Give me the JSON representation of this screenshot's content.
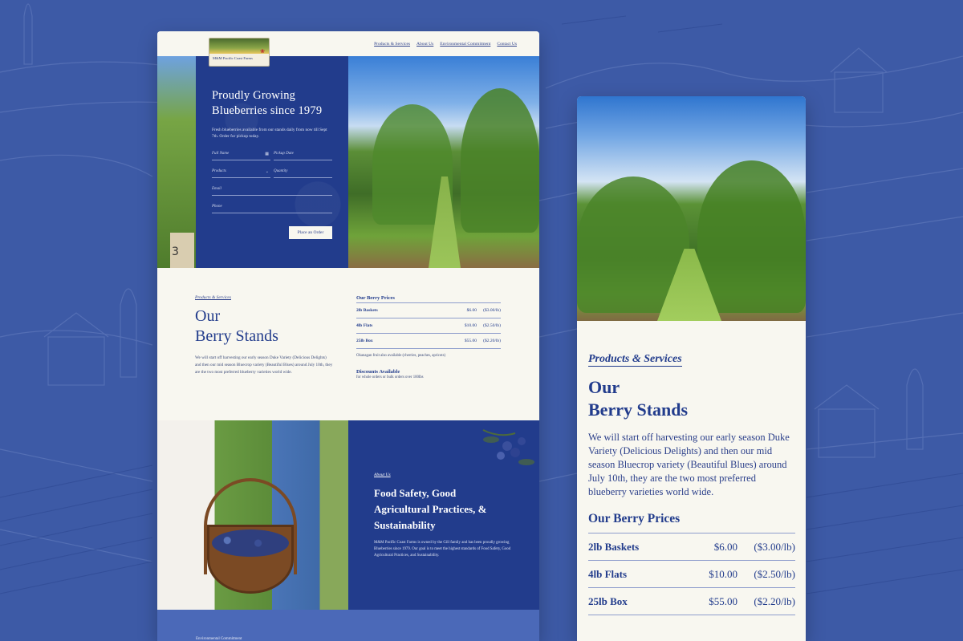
{
  "colors": {
    "background": "#3d5aa6",
    "navy": "#223c8c",
    "cream": "#f8f7f0",
    "accent_blue": "#4b69b8"
  },
  "desktop": {
    "logo_text": "M&M Pacific Coast Farms",
    "nav": [
      "Products & Services",
      "About Us",
      "Environmental Commitment",
      "Contact Us"
    ],
    "hero": {
      "title": "Proudly Growing Blueberries since 1979",
      "subtitle": "Fresh blueberries available from our stands daily from now till Sept 7th. Order for pickup today.",
      "fields": {
        "full_name": "Full Name",
        "pickup_date": "Pickup Date",
        "products": "Products",
        "quantity": "Quantity",
        "email": "Email",
        "phone": "Phone"
      },
      "button": "Place an Order",
      "post_number": "3"
    },
    "stands": {
      "kicker": "Products & Services",
      "title_line1": "Our",
      "title_line2": "Berry Stands",
      "body": "We will start off harvesting our early season Duke Variety (Delicious Delights) and then our mid season Bluecrop variety (Beautiful Blues) around July 10th, they are the two most preferred blueberry varieties world wide.",
      "prices_title": "Our Berry Prices",
      "prices": [
        {
          "name": "2lb Baskets",
          "price": "$6.00",
          "unit": "($3.00/lb)"
        },
        {
          "name": "4lb Flats",
          "price": "$10.00",
          "unit": "($2.50/lb)"
        },
        {
          "name": "25lb Box",
          "price": "$55.00",
          "unit": "($2.20/lb)"
        }
      ],
      "note": "Okanagan fruit also available (cherries, peaches, apricots)",
      "discount_title": "Discounts Available",
      "discount_sub": "for whole orders or bulk orders over 100lbs"
    },
    "about": {
      "kicker": "About Us",
      "title": "Food Safety, Good Agricultural Practices, & Sustainability",
      "body": "M&M Pacific Coast Farms is owned by the Gill family and has been proudly growing Blueberries since 1979. Our goal is to meet the highest standards of Food Safety, Good Agricultural Practices, and Sustainability."
    },
    "bottom_label": "Environmental Commitment"
  },
  "mobile": {
    "kicker": "Products & Services",
    "title_line1": "Our",
    "title_line2": "Berry Stands",
    "body": "We will start off harvesting our early season Duke Variety (Delicious Delights) and then our mid season Bluecrop variety (Beautiful Blues) around July 10th, they are the two most preferred blueberry varieties world wide.",
    "prices_title": "Our Berry Prices",
    "prices": [
      {
        "name": "2lb Baskets",
        "price": "$6.00",
        "unit": "($3.00/lb)"
      },
      {
        "name": "4lb Flats",
        "price": "$10.00",
        "unit": "($2.50/lb)"
      },
      {
        "name": "25lb Box",
        "price": "$55.00",
        "unit": "($2.20/lb)"
      }
    ]
  }
}
